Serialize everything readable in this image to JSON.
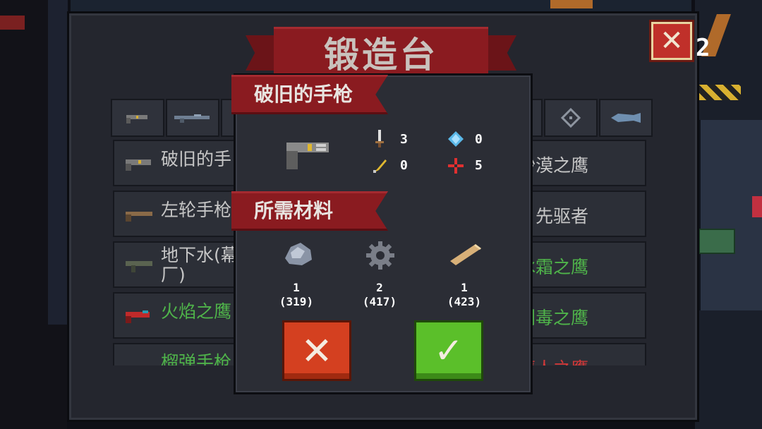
{
  "title": "锻造台",
  "close_icon": "✕",
  "hud_counter": "2",
  "tabs": [
    {
      "icon": "pistol-icon"
    },
    {
      "icon": "rifle-icon"
    },
    {
      "icon": "smg-icon"
    },
    {
      "icon": "hidden-tab-icon"
    },
    {
      "icon": "hidden-tab-icon"
    },
    {
      "icon": "hidden-tab-icon"
    },
    {
      "icon": "hidden-tab-icon"
    },
    {
      "icon": "shotgun-icon"
    },
    {
      "icon": "crosshair-icon"
    },
    {
      "icon": "fish-gun-icon"
    }
  ],
  "weapon_rows": [
    {
      "left_name": "破旧的手",
      "right_name": "沙漠之鹰",
      "left_color": "#c6c6c6",
      "right_color": "#c6c6c6"
    },
    {
      "left_name": "左轮手枪",
      "right_name": "先驱者",
      "left_color": "#c6c6c6",
      "right_color": "#c6c6c6"
    },
    {
      "left_name": "地下水(幕",
      "left_name_line2": "厂)",
      "right_name": "冰霜之鹰",
      "left_color": "#c6c6c6",
      "right_color": "#4fb44a"
    },
    {
      "left_name": "火焰之鹰",
      "right_name": "剧毒之鹰",
      "left_color": "#4fb44a",
      "right_color": "#4fb44a"
    },
    {
      "left_name": "榴弹手枪",
      "right_name": "鹰人之鹰",
      "left_color": "#4fb44a",
      "right_color": "#d03838"
    }
  ],
  "popup": {
    "weapon_name": "破旧的手枪",
    "stats": {
      "damage": "3",
      "energy": "0",
      "crit": "0",
      "accuracy": "5"
    },
    "materials_title": "所需材料",
    "materials": [
      {
        "icon": "ore-icon",
        "required": "1",
        "owned": "(319)"
      },
      {
        "icon": "gear-icon",
        "required": "2",
        "owned": "(417)"
      },
      {
        "icon": "wood-icon",
        "required": "1",
        "owned": "(423)"
      }
    ],
    "cancel_icon": "✕",
    "confirm_icon": "✓"
  },
  "colors": {
    "panel": "#24262e",
    "ribbon": "#8a1b20",
    "cancel": "#d44020",
    "confirm": "#5bbf2a",
    "rare_green": "#4fb44a",
    "legendary_red": "#d03838"
  }
}
